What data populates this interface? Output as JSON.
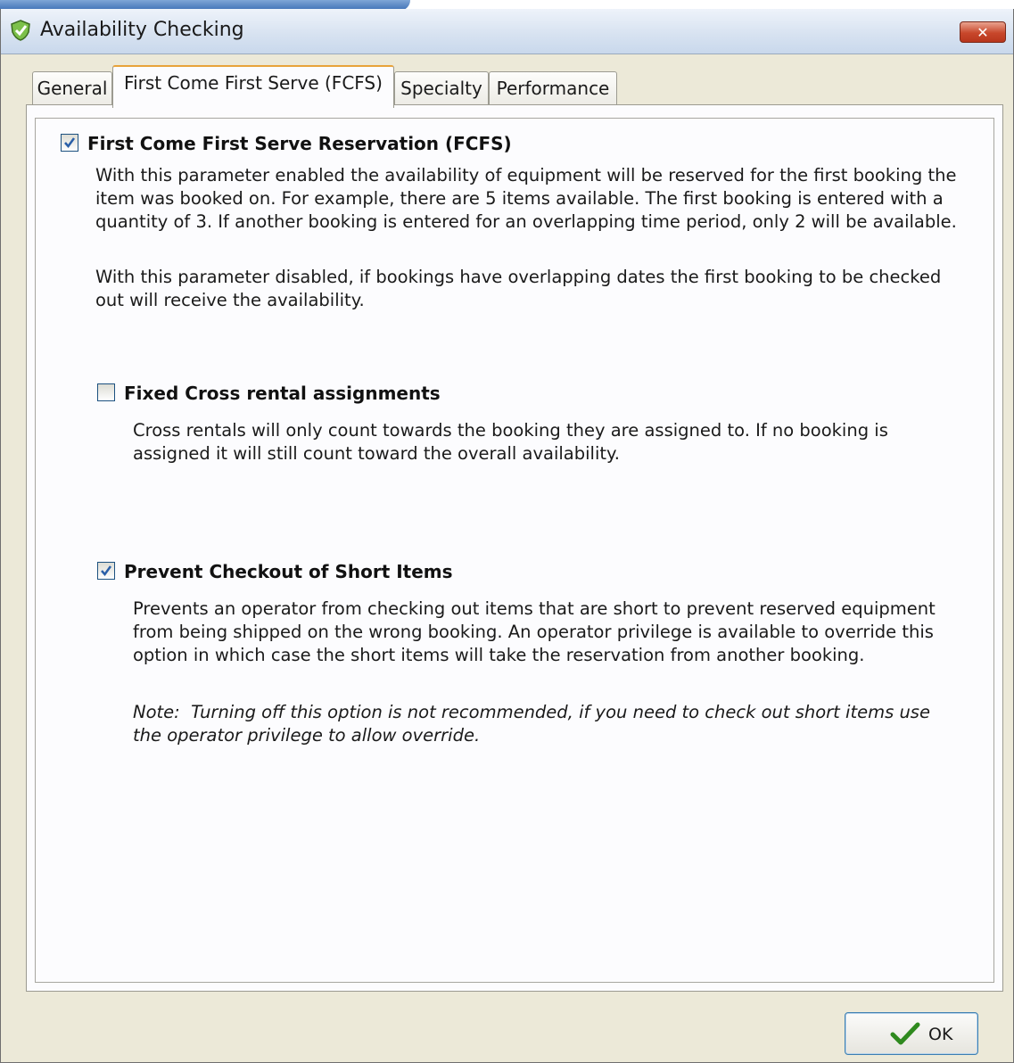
{
  "window": {
    "title": "Availability Checking",
    "close_label": "✕"
  },
  "tabs": [
    {
      "label": "General",
      "active": false
    },
    {
      "label": "First Come First Serve (FCFS)",
      "active": true
    },
    {
      "label": "Specialty",
      "active": false
    },
    {
      "label": "Performance",
      "active": false
    }
  ],
  "options": {
    "fcfs": {
      "label": "First Come First Serve Reservation (FCFS)",
      "checked": true,
      "description_1": "With this parameter enabled the availability of equipment will be reserved for the first booking the\nitem was booked on. For example, there are 5 items available. The first booking is entered with a\nquantity of 3. If another booking is entered for an overlapping time period, only 2 will be available.",
      "description_2": "With this parameter disabled, if bookings have overlapping dates the first booking to be checked\nout will receive the availability."
    },
    "fixed_cross": {
      "label": "Fixed Cross rental assignments",
      "checked": false,
      "description": "Cross rentals will only count towards the booking they are assigned to. If no booking is\nassigned it will still count toward the overall availability."
    },
    "prevent_checkout": {
      "label": "Prevent Checkout of Short Items",
      "checked": true,
      "description": "Prevents an operator from checking out items that are short to prevent reserved equipment\nfrom being shipped on the wrong booking. An operator privilege is available to override this\noption in which case the short items will take the reservation from another booking.",
      "note": "Note:  Turning off this option is not recommended, if you need to check out short items use\nthe operator privilege to allow override."
    }
  },
  "footer": {
    "ok_label": "OK"
  },
  "colors": {
    "accent": "#e8a33a",
    "check": "#2a5fa8",
    "ok_check": "#2f8a1e"
  }
}
